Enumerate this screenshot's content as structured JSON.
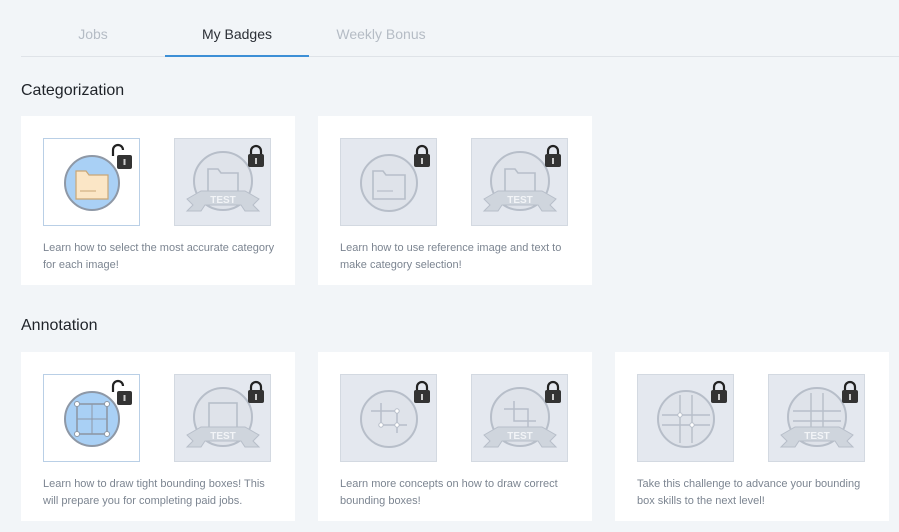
{
  "tabs": [
    {
      "label": "Jobs",
      "active": false
    },
    {
      "label": "My Badges",
      "active": true
    },
    {
      "label": "Weekly Bonus",
      "active": false
    }
  ],
  "sections": [
    {
      "title": "Categorization",
      "cards": [
        {
          "description": "Learn how to select the most accurate category for each image!",
          "badges": [
            {
              "icon": "folder-badge-icon",
              "state": "unlocked"
            },
            {
              "icon": "folder-test-badge-icon",
              "state": "locked",
              "ribbon": "TEST"
            }
          ]
        },
        {
          "description": "Learn how to use reference image and text to make category selection!",
          "badges": [
            {
              "icon": "folder-badge-icon",
              "state": "locked"
            },
            {
              "icon": "folder-test-badge-icon",
              "state": "locked",
              "ribbon": "TEST"
            }
          ]
        }
      ]
    },
    {
      "title": "Annotation",
      "cards": [
        {
          "description": "Learn how to draw tight bounding boxes! This will prepare you for completing paid jobs.",
          "badges": [
            {
              "icon": "bounding-box-badge-icon",
              "state": "unlocked"
            },
            {
              "icon": "bounding-box-test-badge-icon",
              "state": "locked",
              "ribbon": "TEST"
            }
          ]
        },
        {
          "description": "Learn more concepts on how to draw correct bounding boxes!",
          "badges": [
            {
              "icon": "multi-box-badge-icon",
              "state": "locked"
            },
            {
              "icon": "multi-box-test-badge-icon",
              "state": "locked",
              "ribbon": "TEST"
            }
          ]
        },
        {
          "description": "Take this challenge to advance your bounding box skills to the next level!",
          "badges": [
            {
              "icon": "grid-box-badge-icon",
              "state": "locked"
            },
            {
              "icon": "grid-box-test-badge-icon",
              "state": "locked",
              "ribbon": "TEST"
            }
          ]
        }
      ]
    }
  ],
  "colors": {
    "accent": "#3d8fd6",
    "badge_active_fill": "#a9d0f5",
    "badge_locked_fill": "#dfe3ea",
    "folder_fill": "#fbe6c6"
  }
}
